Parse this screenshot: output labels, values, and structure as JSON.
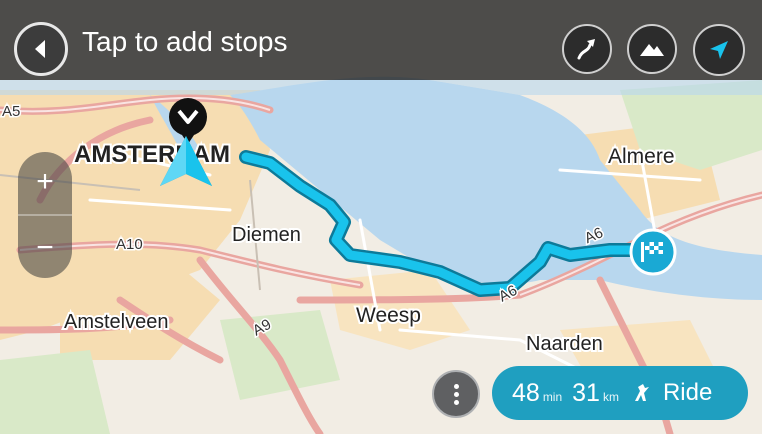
{
  "header": {
    "title": "Tap to add stops"
  },
  "map": {
    "places": {
      "amsterdam": "AMSTERDAM",
      "diemen": "Diemen",
      "almere": "Almere",
      "weesp": "Weesp",
      "amstelveen": "Amstelveen",
      "naarden": "Naarden"
    },
    "roads": {
      "a5": "A5",
      "a10": "A10",
      "a9": "A9",
      "a6_west": "A6",
      "a6_east": "A6"
    }
  },
  "zoom": {
    "in_label": "+",
    "out_label": "−"
  },
  "route_summary": {
    "time_value": "48",
    "time_unit": "min",
    "distance_value": "31",
    "distance_unit": "km",
    "ride_label": "Ride"
  },
  "colors": {
    "route": "#19c3ec",
    "water": "#b8d7ee",
    "land": "#f2ede4",
    "urban": "#f6ddb2",
    "green": "#d9e9c8",
    "motorway": "#e9a6a0",
    "panel_accent": "#1f9fc0"
  },
  "icons": {
    "back": "back-arrow-icon",
    "route": "route-icon",
    "terrain": "terrain-icon",
    "locate": "locate-arrow-icon",
    "destination": "checkered-flag-icon",
    "current": "current-location-arrow-icon",
    "more": "more-dots-icon",
    "ride": "motorcycle-icon"
  }
}
